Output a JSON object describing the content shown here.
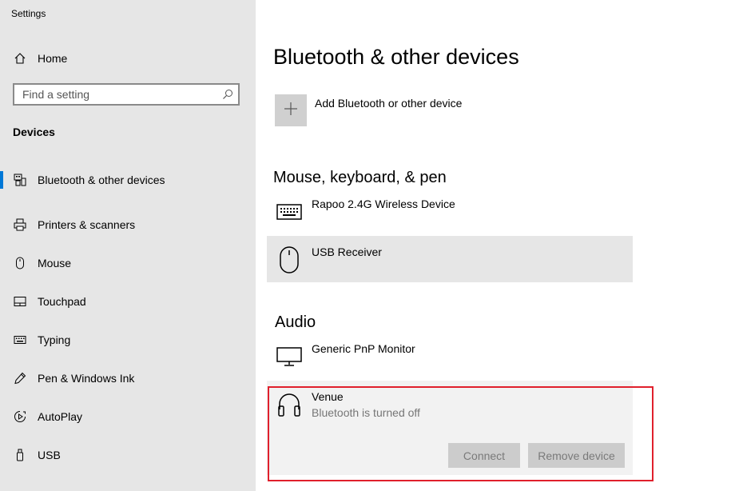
{
  "app": {
    "title": "Settings"
  },
  "sidebar": {
    "home_label": "Home",
    "search_placeholder": "Find a setting",
    "section_label": "Devices",
    "items": [
      {
        "label": "Bluetooth & other devices",
        "icon": "bluetooth-devices-icon",
        "selected": true
      },
      {
        "label": "Printers & scanners",
        "icon": "printer-icon"
      },
      {
        "label": "Mouse",
        "icon": "mouse-icon"
      },
      {
        "label": "Touchpad",
        "icon": "touchpad-icon"
      },
      {
        "label": "Typing",
        "icon": "keyboard-icon"
      },
      {
        "label": "Pen & Windows Ink",
        "icon": "pen-icon"
      },
      {
        "label": "AutoPlay",
        "icon": "autoplay-icon"
      },
      {
        "label": "USB",
        "icon": "usb-icon"
      }
    ]
  },
  "main": {
    "title": "Bluetooth & other devices",
    "add_device_label": "Add Bluetooth or other device",
    "mouse_section": {
      "title": "Mouse, keyboard, & pen",
      "devices": [
        {
          "name": "Rapoo 2.4G Wireless Device",
          "icon": "keyboard-icon"
        },
        {
          "name": "USB Receiver",
          "icon": "mouse-icon"
        }
      ]
    },
    "audio_section": {
      "title": "Audio",
      "devices": [
        {
          "name": "Generic PnP Monitor",
          "icon": "monitor-icon"
        },
        {
          "name": "Venue",
          "status": "Bluetooth is turned off",
          "icon": "headphones-icon",
          "connect_label": "Connect",
          "remove_label": "Remove device"
        }
      ]
    }
  },
  "colors": {
    "accent": "#0078d7",
    "highlight": "#e0202c",
    "sidebar_bg": "#e6e6e6"
  }
}
